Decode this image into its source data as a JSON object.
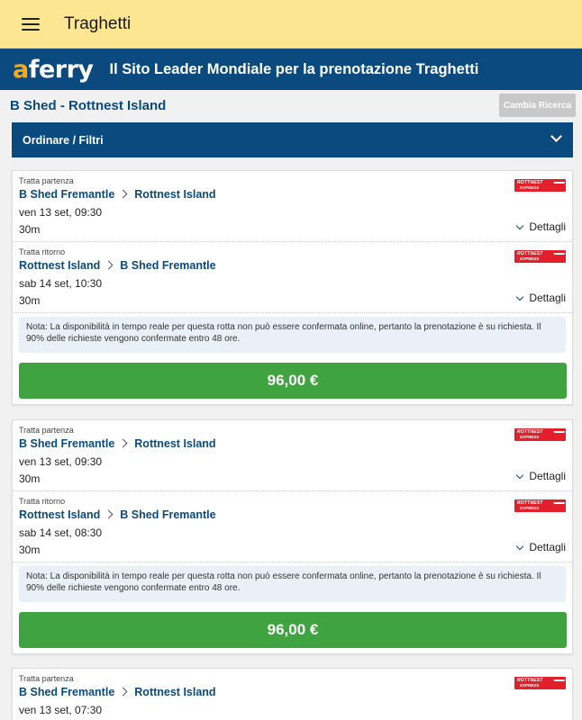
{
  "appbar": {
    "title": "Traghetti",
    "menu_icon": "hamburger-menu-icon"
  },
  "banner": {
    "logo_a": "a",
    "logo_rest": "ferry",
    "tagline": "Il Sito Leader Mondiale per la prenotazione Traghetti"
  },
  "header": {
    "route_title": "B Shed - Rottnest Island",
    "change_button": "Cambia Ricerca"
  },
  "filters": {
    "label": "Ordinare / Filtri"
  },
  "operator": {
    "line1": "ROTTNEST",
    "line2": "EXPRESS"
  },
  "results": [
    {
      "outbound": {
        "kind": "Tratta partenza",
        "from": "B Shed Fremantle",
        "to": "Rottnest Island",
        "date": "ven 13 set, 09:30",
        "duration": "30m",
        "details": "Dettagli"
      },
      "return": {
        "kind": "Tratta ritorno",
        "from": "Rottnest Island",
        "to": "B Shed Fremantle",
        "date": "sab 14 set, 10:30",
        "duration": "30m",
        "details": "Dettagli"
      },
      "note": "Nota: La disponibilità in tempo reale per questa rotta non può essere confermata online, pertanto la prenotazione è su richiesta. Il 90% delle richieste vengono confermate entro 48 ore.",
      "price": "96,00 €"
    },
    {
      "outbound": {
        "kind": "Tratta partenza",
        "from": "B Shed Fremantle",
        "to": "Rottnest Island",
        "date": "ven 13 set, 09:30",
        "duration": "30m",
        "details": "Dettagli"
      },
      "return": {
        "kind": "Tratta ritorno",
        "from": "Rottnest Island",
        "to": "B Shed Fremantle",
        "date": "sab 14 set, 08:30",
        "duration": "30m",
        "details": "Dettagli"
      },
      "note": "Nota: La disponibilità in tempo reale per questa rotta non può essere confermata online, pertanto la prenotazione è su richiesta. Il 90% delle richieste vengono confermate entro 48 ore.",
      "price": "96,00 €"
    },
    {
      "outbound": {
        "kind": "Tratta partenza",
        "from": "B Shed Fremantle",
        "to": "Rottnest Island",
        "date": "ven 13 set, 07:30"
      }
    }
  ]
}
